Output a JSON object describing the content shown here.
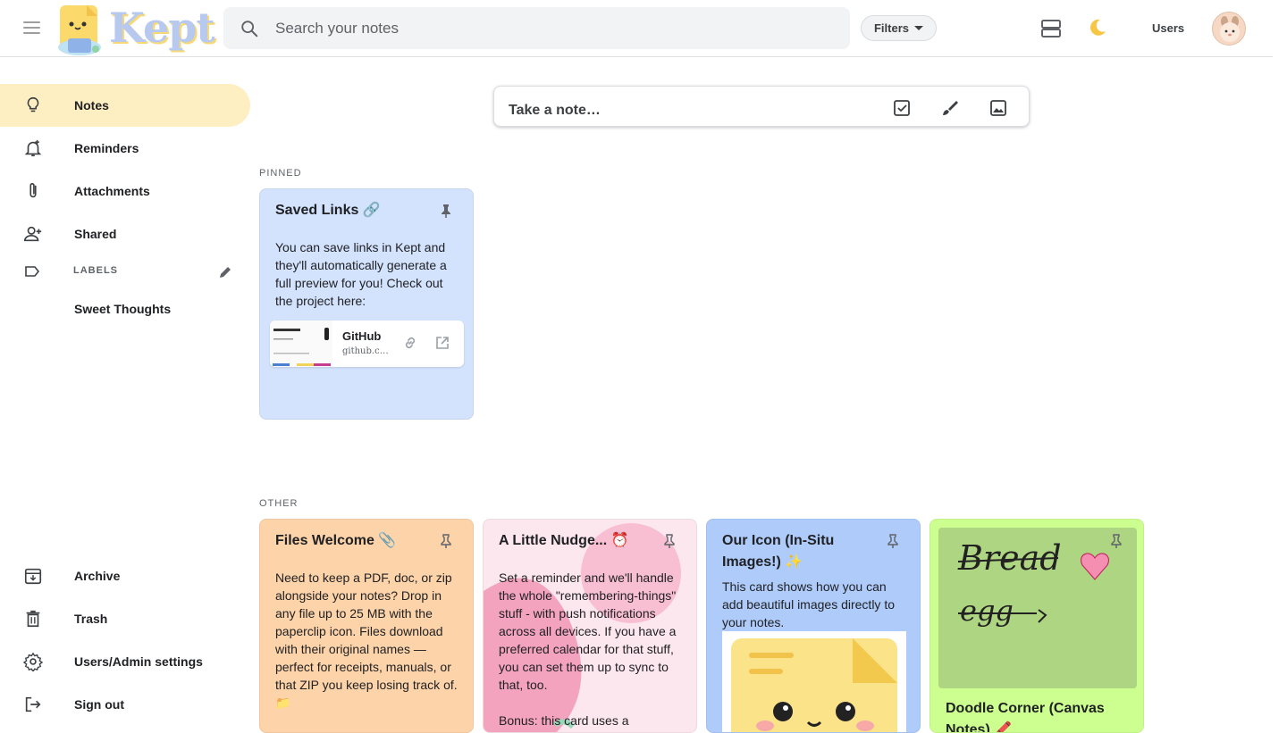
{
  "header": {
    "app_name": "Kept",
    "search_placeholder": "Search your notes",
    "filters_label": "Filters",
    "users_label": "Users"
  },
  "sidebar": {
    "items": [
      {
        "label": "Notes",
        "icon": "lightbulb-icon",
        "active": true
      },
      {
        "label": "Reminders",
        "icon": "bell-plus-icon"
      },
      {
        "label": "Attachments",
        "icon": "paperclip-icon"
      },
      {
        "label": "Shared",
        "icon": "person-add-icon"
      }
    ],
    "labels_heading": "LABELS",
    "labels": [
      {
        "label": "Sweet Thoughts"
      }
    ],
    "bottom_items": [
      {
        "label": "Archive",
        "icon": "archive-icon"
      },
      {
        "label": "Trash",
        "icon": "trash-icon"
      },
      {
        "label": "Users/Admin settings",
        "icon": "gear-icon"
      },
      {
        "label": "Sign out",
        "icon": "logout-icon"
      }
    ]
  },
  "take_note": {
    "placeholder": "Take a note…"
  },
  "sections": {
    "pinned": "PINNED",
    "other": "OTHER"
  },
  "pinned_notes": [
    {
      "title": "Saved Links 🔗",
      "body": "You can save links in Kept and they'll automatically generate a full preview for you! Check out the project here:",
      "color": "#d3e3fd",
      "link": {
        "title": "GitHub",
        "url": "github.com"
      }
    }
  ],
  "other_notes": [
    {
      "title": "Files Welcome 📎",
      "body": "Need to keep a PDF, doc, or zip alongside your notes? Drop in any file up to 25 MB with the paperclip icon. Files download with their original names — perfect for receipts, manuals, or that ZIP you keep losing track of. 📁",
      "color": "#fdd3a9"
    },
    {
      "title": "A Little Nudge... ⏰",
      "body": "Set a reminder and we'll handle the whole \"remembering-things\" stuff - with push notifications across all devices. If you have a preferred calendar for that stuff, you can set them up to sync to that, too.",
      "body2": "Bonus: this card uses a",
      "color": "#fde7ee"
    },
    {
      "title": "Our Icon (In-Situ Images!) ✨",
      "body": "This card shows how you can add beautiful images directly to your notes.",
      "color": "#aecbfa"
    },
    {
      "title": "Doodle Corner (Canvas Notes) 🖍️",
      "doodle_words": [
        "Bread",
        "egg"
      ],
      "color": "#ccff90"
    }
  ]
}
